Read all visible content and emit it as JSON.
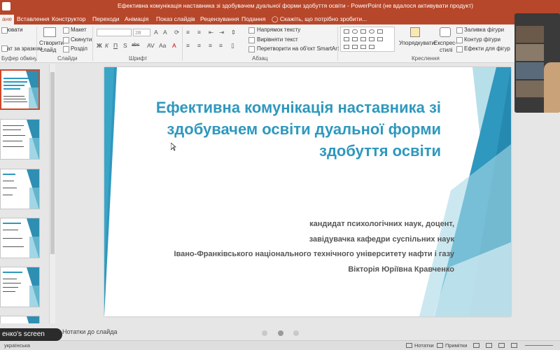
{
  "window": {
    "title": "Ефективна комунікація наставника зі здобувачем дуальної форми здобуття освіти - PowerPoint (не вдалося активувати продукт)"
  },
  "ribbon_tabs": [
    {
      "label": "ане"
    },
    {
      "label": "Вставлення"
    },
    {
      "label": "Конструктор"
    },
    {
      "label": "Переходи"
    },
    {
      "label": "Анімація"
    },
    {
      "label": "Показ слайдів"
    },
    {
      "label": "Рецензування"
    },
    {
      "label": "Подання"
    }
  ],
  "tell_me": "Скажіть, що потрібно зробити...",
  "ribbon": {
    "clipboard": {
      "copy": "ювати",
      "format_painter": "ат за зразком",
      "group": "Буфер обміну"
    },
    "slides": {
      "new_slide_1": "Створити",
      "new_slide_2": "слайд",
      "layout": "Макет",
      "reset": "Скинути",
      "section": "Розділ",
      "group": "Слайди"
    },
    "font": {
      "size": "28",
      "group": "Шрифт",
      "bold": "Ж",
      "italic": "К",
      "underline": "П",
      "shadow": "S",
      "strike": "abc"
    },
    "paragraph": {
      "text_direction": "Напрямок тексту",
      "align_text": "Вирівняти текст",
      "smartart": "Перетворити на об'єкт SmartArt",
      "group": "Абзац"
    },
    "drawing": {
      "arrange": "Упорядкувати",
      "quick_styles_1": "Експрес-",
      "quick_styles_2": "стилі",
      "fill": "Заливка фігури",
      "outline": "Контур фігури",
      "effects": "Ефекти для фігур",
      "group": "Креслення"
    }
  },
  "slide": {
    "title": "Ефективна комунікація наставника зі здобувачем освіти дуальної форми здобуття освіти",
    "subtitle_lines": [
      "кандидат психологічних наук, доцент,",
      "завідувачка кафедри суспільних наук",
      "Івано-Франківського національного технічного університету нафти і газу",
      "Вікторія Юріївна Кравченко"
    ]
  },
  "thumbnails": [
    {
      "number": "1"
    },
    {
      "number": "2"
    },
    {
      "number": "3"
    },
    {
      "number": "4"
    },
    {
      "number": "5"
    },
    {
      "number": "6"
    }
  ],
  "notes_label": "Нотатки до слайда",
  "status": {
    "language": "українська",
    "notes": "Нотатки",
    "comments": "Примітки"
  },
  "screen_share_label": "енко's screen",
  "colors": {
    "accent": "#b7472a",
    "slide_blue": "#2f98be",
    "slide_teal": "#7ac4d8"
  }
}
